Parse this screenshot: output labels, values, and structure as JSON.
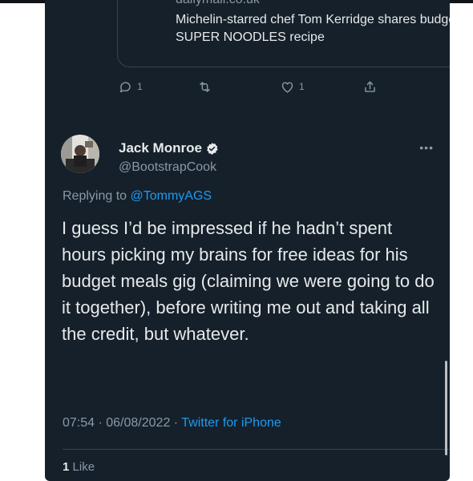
{
  "link_card": {
    "domain": "dailymail.co.uk",
    "title": "Michelin-starred chef Tom Kerridge shares budget SUPER NOODLES recipe"
  },
  "parent_actions": {
    "reply_count": "1",
    "like_count": "1",
    "icons": [
      "reply-icon",
      "retweet-icon",
      "like-icon",
      "share-icon"
    ]
  },
  "tweet": {
    "author_name": "Jack Monroe",
    "author_handle": "@BootstrapCook",
    "replying_prefix": "Replying to",
    "replying_to": "@TommyAGS",
    "text": "I guess I’d be impressed if he hadn’t spent hours picking my brains for free ideas for his budget meals gig (claiming we were going to do it together), before writing me out and taking all the credit, but whatever.",
    "timestamp": "07:54 · 06/08/2022 ·",
    "source": "Twitter for iPhone",
    "like_count": "1",
    "like_label": "Like"
  },
  "colors": {
    "background": "#15202b",
    "text": "#e7e9ea",
    "secondary": "#8b98a5",
    "accent": "#1d9bf0",
    "border": "#38444d"
  }
}
